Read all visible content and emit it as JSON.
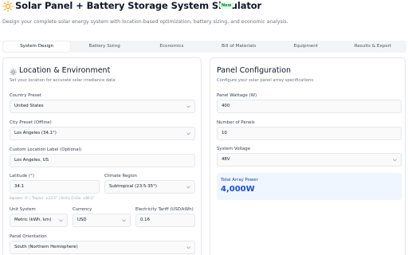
{
  "header": {
    "logo_icon": "sun-icon",
    "title": "Solar Panel + Battery Storage System Simulator",
    "badge": "New",
    "subtitle": "Design your complete solar energy system with location-based optimization, battery sizing, and economic analysis."
  },
  "tabs": [
    {
      "label": "System Design",
      "active": true
    },
    {
      "label": "Battery Sizing",
      "active": false
    },
    {
      "label": "Economics",
      "active": false
    },
    {
      "label": "Bill of Materials",
      "active": false
    },
    {
      "label": "Equipment",
      "active": false
    },
    {
      "label": "Results & Export",
      "active": false
    }
  ],
  "location": {
    "icon": "sun-icon",
    "title": "Location & Environment",
    "description": "Set your location for accurate solar irradiance data",
    "country_preset": {
      "label": "Country Preset",
      "value": "United States"
    },
    "city_preset": {
      "label": "City Preset (Offline)",
      "value": "Los Angeles (34.1°)"
    },
    "custom_label": {
      "label": "Custom Location Label (Optional)",
      "value": "Los Angeles, US"
    },
    "latitude": {
      "label": "Latitude (°)",
      "value": "34.1",
      "hint": "Equator: 0° | Tropics: ±23.5° | Arctic Circle: ±66.5°"
    },
    "climate_region": {
      "label": "Climate Region",
      "value": "Subtropical (23.5-35°)"
    },
    "unit_system": {
      "label": "Unit System",
      "value": "Metric (kWh, km)"
    },
    "currency": {
      "label": "Currency",
      "value": "USD"
    },
    "tariff": {
      "label": "Electricity Tariff (USD/kWh)",
      "value": "0.16"
    },
    "panel_orientation": {
      "label": "Panel Orientation",
      "value": "South (Northern Hemisphere)"
    }
  },
  "panel": {
    "title": "Panel Configuration",
    "description": "Configure your solar panel array specifications",
    "wattage": {
      "label": "Panel Wattage (W)",
      "value": "400"
    },
    "count": {
      "label": "Number of Panels",
      "value": "10"
    },
    "voltage": {
      "label": "System Voltage",
      "value": "48V"
    },
    "total": {
      "label": "Total Array Power",
      "value": "4,000W"
    }
  },
  "colors": {
    "accent_blue": "#1d4ed8",
    "badge_green": "#15803d",
    "sun_yellow": "#f59e0b"
  }
}
